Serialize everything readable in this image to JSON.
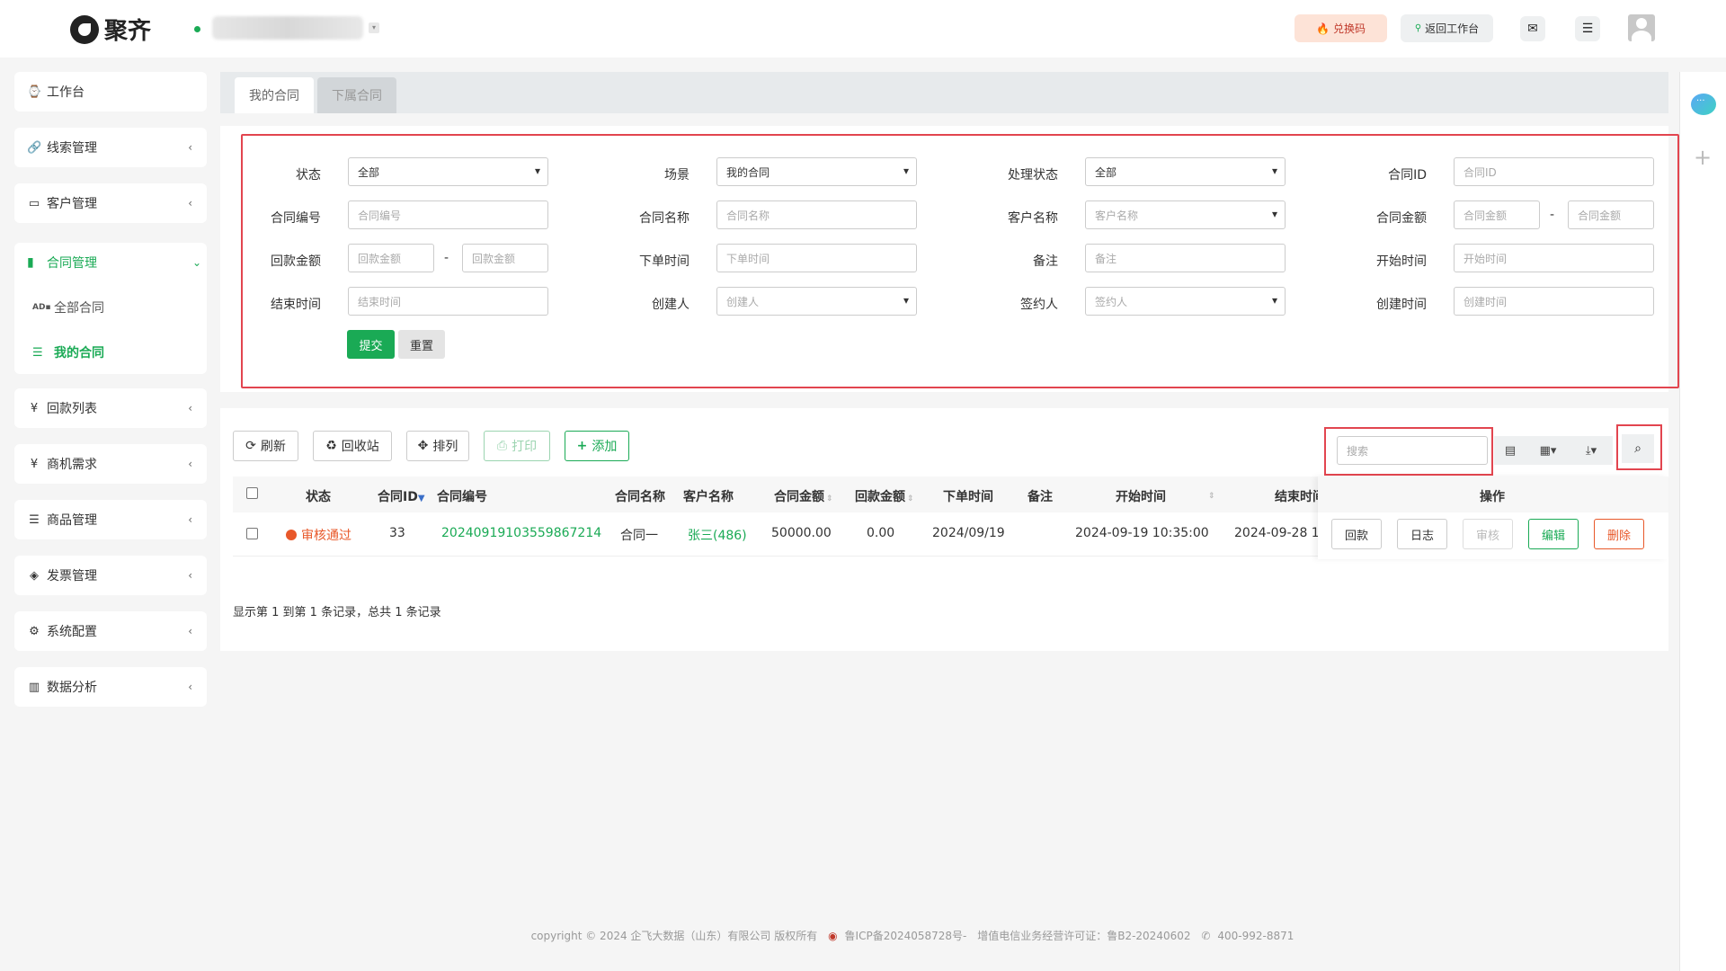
{
  "header": {
    "logo_text": "聚齐",
    "redeem_label": "兑换码",
    "back_label": "返回工作台"
  },
  "sidebar": {
    "items": [
      {
        "icon": "dashboard-icon",
        "label": "工作台"
      },
      {
        "icon": "link-icon",
        "label": "线索管理"
      },
      {
        "icon": "id-card-icon",
        "label": "客户管理"
      },
      {
        "icon": "bookmark-icon",
        "label": "合同管理"
      },
      {
        "icon": "yen-icon",
        "label": "回款列表"
      },
      {
        "icon": "yen-icon",
        "label": "商机需求"
      },
      {
        "icon": "list-icon",
        "label": "商品管理"
      },
      {
        "icon": "tag-icon",
        "label": "发票管理"
      },
      {
        "icon": "gears-icon",
        "label": "系统配置"
      },
      {
        "icon": "bar-chart-icon",
        "label": "数据分析"
      }
    ],
    "sub_items": [
      {
        "icon": "ad-icon",
        "label": "全部合同"
      },
      {
        "icon": "table-list-icon",
        "label": "我的合同"
      }
    ]
  },
  "tabs": [
    {
      "label": "我的合同",
      "active": true
    },
    {
      "label": "下属合同",
      "active": false
    }
  ],
  "filters": {
    "status_label": "状态",
    "status_value": "全部",
    "scene_label": "场景",
    "scene_value": "我的合同",
    "process_label": "处理状态",
    "process_value": "全部",
    "contract_id_label": "合同ID",
    "contract_id_ph": "合同ID",
    "contract_no_label": "合同编号",
    "contract_no_ph": "合同编号",
    "contract_name_label": "合同名称",
    "contract_name_ph": "合同名称",
    "customer_label": "客户名称",
    "customer_ph": "客户名称",
    "amount_label": "合同金额",
    "amount_from_ph": "合同金额",
    "amount_to_ph": "合同金额",
    "payback_label": "回款金额",
    "payback_from_ph": "回款金额",
    "payback_to_ph": "回款金额",
    "order_time_label": "下单时间",
    "order_time_ph": "下单时间",
    "remark_label": "备注",
    "remark_ph": "备注",
    "start_time_label": "开始时间",
    "start_time_ph": "开始时间",
    "end_time_label": "结束时间",
    "end_time_ph": "结束时间",
    "creator_label": "创建人",
    "creator_ph": "创建人",
    "signer_label": "签约人",
    "signer_ph": "签约人",
    "created_time_label": "创建时间",
    "created_time_ph": "创建时间",
    "dash": "-",
    "submit_label": "提交",
    "reset_label": "重置"
  },
  "toolbar": {
    "refresh_label": "刷新",
    "recycle_label": "回收站",
    "sort_label": "排列",
    "print_label": "打印",
    "add_label": "添加",
    "search_ph": "搜索"
  },
  "table": {
    "columns": [
      "状态",
      "合同ID",
      "合同编号",
      "合同名称",
      "客户名称",
      "合同金额",
      "回款金额",
      "下单时间",
      "备注",
      "开始时间",
      "结束时间",
      "操作"
    ],
    "rows": [
      {
        "status": "审核通过",
        "id": "33",
        "no": "20240919103559867214",
        "name": "合同一",
        "customer": "张三(486)",
        "amount": "50000.00",
        "payback": "0.00",
        "order_time": "2024/09/19",
        "remark": "",
        "start_time": "2024-09-19 10:35:00",
        "end_time": "2024-09-28 1"
      }
    ],
    "ops": [
      "回款",
      "日志",
      "审核",
      "编辑",
      "删除"
    ],
    "pagination": "显示第 1 到第 1 条记录，总共 1 条记录"
  },
  "footer": {
    "copyright": "copyright © 2024 企飞大数据（山东）有限公司 版权所有",
    "icp": "鲁ICP备2024058728号-",
    "license": "增值电信业务经营许可证：鲁B2-20240602",
    "phone": "400-992-8871"
  },
  "colors": {
    "accent": "#1aaa55",
    "danger": "#e8582a",
    "highlight_border": "#e2454f"
  }
}
